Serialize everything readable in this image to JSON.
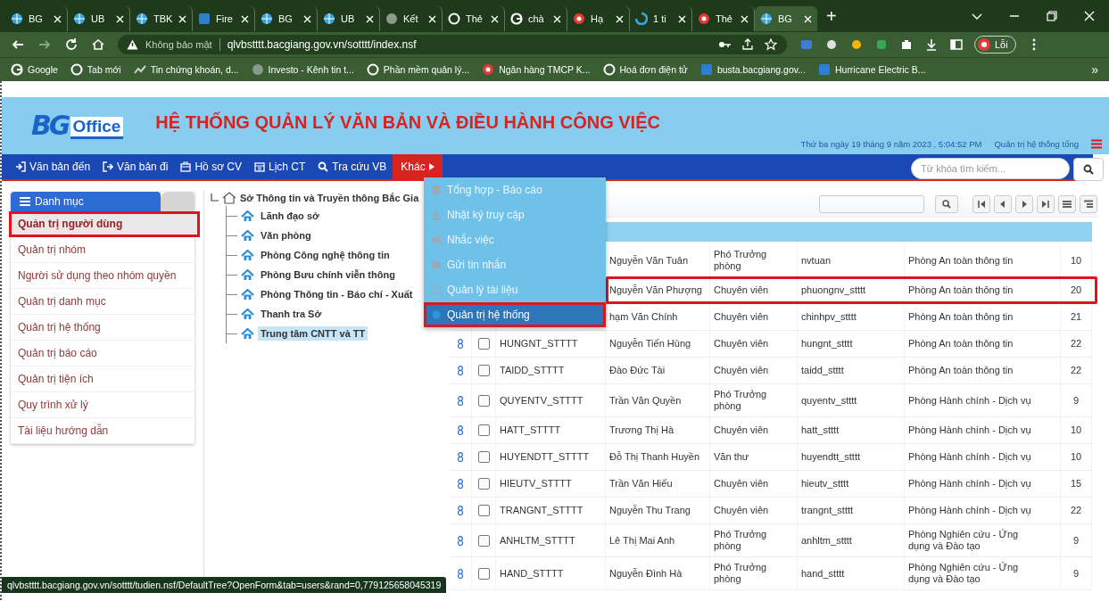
{
  "browser": {
    "tabs": [
      {
        "label": "BG",
        "kind": "globe",
        "selected": false
      },
      {
        "label": "UB",
        "kind": "globe",
        "selected": false
      },
      {
        "label": "TBK",
        "kind": "globe",
        "selected": false
      },
      {
        "label": "Fire",
        "kind": "square",
        "selected": false
      },
      {
        "label": "BG",
        "kind": "globe",
        "selected": false
      },
      {
        "label": "UB",
        "kind": "globe",
        "selected": false
      },
      {
        "label": "Kết",
        "kind": "grey",
        "selected": false
      },
      {
        "label": "Thẻ",
        "kind": "circle",
        "selected": false
      },
      {
        "label": "chà",
        "kind": "google",
        "selected": false
      },
      {
        "label": "Hạ",
        "kind": "red",
        "selected": false
      },
      {
        "label": "1 ti",
        "kind": "blue",
        "selected": false
      },
      {
        "label": "Thẻ",
        "kind": "red",
        "selected": false
      },
      {
        "label": "BG",
        "kind": "globe",
        "selected": true
      }
    ],
    "address": {
      "security": "Không bảo mật",
      "url": "qlvbstttt.bacgiang.gov.vn/sotttt/index.nsf",
      "profile_label": "Lỗi"
    },
    "bookmarks": [
      {
        "label": "Google",
        "kind": "google"
      },
      {
        "label": "Tab mới",
        "kind": "circle"
      },
      {
        "label": "Tin chứng khoán, d...",
        "kind": "inv"
      },
      {
        "label": "Investo - Kênh tin t...",
        "kind": "grey"
      },
      {
        "label": "Phần mềm quản lý...",
        "kind": "circle"
      },
      {
        "label": "Ngân hàng TMCP K...",
        "kind": "red"
      },
      {
        "label": "Hoá đơn điện tử",
        "kind": "circle"
      },
      {
        "label": "busta.bacgiang.gov...",
        "kind": "square"
      },
      {
        "label": "Hurricane Electric B...",
        "kind": "square"
      }
    ],
    "bookmarks_more": "»",
    "new_tab_label": "+"
  },
  "app": {
    "logo_mark": "BG",
    "logo_text": "Office",
    "title": "HỆ THỐNG QUẢN LÝ VĂN BẢN VÀ ĐIỀU HÀNH CÔNG VIỆC",
    "datetime": "Thứ ba ngày 19 tháng 9 năm 2023 , 5:04:52 PM",
    "user": "Quản trị hệ thống tổng"
  },
  "nav": {
    "items": [
      {
        "label": "Văn bản đến",
        "kind": "in",
        "selected": false
      },
      {
        "label": "Văn bản đi",
        "kind": "out",
        "selected": false
      },
      {
        "label": "Hồ sơ CV",
        "kind": "folder",
        "selected": false
      },
      {
        "label": "Lịch CT",
        "kind": "calendar",
        "selected": false
      },
      {
        "label": "Tra cứu VB",
        "kind": "search",
        "selected": false
      },
      {
        "label": "Khác",
        "kind": "more",
        "selected": true
      }
    ],
    "search": {
      "placeholder": "Từ khóa tìm kiếm..."
    }
  },
  "sidebar": {
    "title": "Danh mục",
    "items": [
      {
        "label": "Quản trị người dùng",
        "selected": true
      },
      {
        "label": "Quản trị nhóm",
        "selected": false
      },
      {
        "label": "Người sử dụng theo nhóm quyền",
        "selected": false
      },
      {
        "label": "Quản trị danh mục",
        "selected": false
      },
      {
        "label": "Quản trị hệ thống",
        "selected": false
      },
      {
        "label": "Quản trị báo cáo",
        "selected": false
      },
      {
        "label": "Quản trị tiện ích",
        "selected": false
      },
      {
        "label": "Quy trình xử lý",
        "selected": false
      },
      {
        "label": "Tài liệu hướng dẫn",
        "selected": false
      }
    ]
  },
  "tree": {
    "label": "Sở Thông tin và Truyền thông Bắc Gia",
    "expanded": true,
    "children": [
      {
        "label": "Lãnh đạo sở",
        "selected": false
      },
      {
        "label": "Văn phòng",
        "selected": false
      },
      {
        "label": "Phòng Công nghệ thông tin",
        "selected": false
      },
      {
        "label": "Phòng Bưu chính viễn thông",
        "selected": false
      },
      {
        "label": "Phòng Thông tin - Báo chí - Xuất",
        "selected": false
      },
      {
        "label": "Thanh tra Sở",
        "selected": false
      },
      {
        "label": "Trung tâm CNTT và TT",
        "selected": true
      }
    ]
  },
  "menu": {
    "items": [
      {
        "label": "Tổng hợp - Báo cáo",
        "kind": "report",
        "selected": false
      },
      {
        "label": "Nhật ký truy cập",
        "kind": "download",
        "selected": false
      },
      {
        "label": "Nhắc việc",
        "kind": "bullhorn",
        "selected": false
      },
      {
        "label": "Gửi tin nhắn",
        "kind": "mail",
        "selected": false
      },
      {
        "label": "Quản lý tài liệu",
        "kind": "folder",
        "selected": false
      },
      {
        "label": "Quản trị hệ thống",
        "kind": "dot",
        "selected": true
      }
    ]
  },
  "table": {
    "rows": [
      {
        "column_4": "Nguyễn Văn Tuân",
        "column_5": "Phó Trưởng phòng",
        "column_6": "nvtuan",
        "column_7": "Phòng An toàn thông tin",
        "column_8": "10",
        "highlighted": false
      },
      {
        "column_4": "Nguyễn Văn Phượng",
        "column_5": "Chuyên viên",
        "column_6": "phuongnv_stttt",
        "column_7": "Phòng An toàn thông tin",
        "column_8": "20",
        "highlighted": true
      },
      {
        "column_4": "hạm Văn Chính",
        "column_5": "Chuyên viên",
        "column_6": "chinhpv_stttt",
        "column_7": "Phòng An toàn thông tin",
        "column_8": "21",
        "highlighted": false
      },
      {
        "checked": false,
        "column_3": "HUNGNT_STTTT",
        "column_4": "Nguyễn Tiến Hùng",
        "column_5": "Chuyên viên",
        "column_6": "hungnt_stttt",
        "column_7": "Phòng An toàn thông tin",
        "column_8": "22",
        "highlighted": false
      },
      {
        "checked": false,
        "column_3": "TAIDD_STTTT",
        "column_4": "Đào Đức Tài",
        "column_5": "Chuyên viên",
        "column_6": "taidd_stttt",
        "column_7": "Phòng An toàn thông tin",
        "column_8": "22",
        "highlighted": false
      },
      {
        "checked": false,
        "column_3": "QUYENTV_STTTT",
        "column_4": "Trần Văn Quyền",
        "column_5": "Phó Trưởng phòng",
        "column_6": "quyentv_stttt",
        "column_7": "Phòng Hành chính - Dịch vụ",
        "column_8": "9",
        "highlighted": false
      },
      {
        "checked": false,
        "column_3": "HATT_STTTT",
        "column_4": "Trương Thị Hà",
        "column_5": "Chuyên viên",
        "column_6": "hatt_stttt",
        "column_7": "Phòng Hành chính - Dịch vụ",
        "column_8": "10",
        "highlighted": false
      },
      {
        "checked": false,
        "column_3": "HUYENDTT_STTTT",
        "column_4": "Đỗ Thị Thanh Huyền",
        "column_5": "Văn thư",
        "column_6": "huyendtt_stttt",
        "column_7": "Phòng Hành chính - Dịch vụ",
        "column_8": "10",
        "highlighted": false
      },
      {
        "checked": false,
        "column_3": "HIEUTV_STTTT",
        "column_4": "Trần Văn Hiếu",
        "column_5": "Chuyên viên",
        "column_6": "hieutv_stttt",
        "column_7": "Phòng Hành chính - Dịch vụ",
        "column_8": "15",
        "highlighted": false
      },
      {
        "checked": false,
        "column_3": "TRANGNT_STTTT",
        "column_4": "Nguyễn Thu Trang",
        "column_5": "Chuyên viên",
        "column_6": "trangnt_stttt",
        "column_7": "Phòng Hành chính - Dịch vụ",
        "column_8": "22",
        "highlighted": false
      },
      {
        "checked": false,
        "column_3": "ANHLTM_STTTT",
        "column_4": "Lê Thị Mai Anh",
        "column_5": "Phó Trưởng phòng",
        "column_6": "anhltm_stttt",
        "column_7": "Phòng Nghiên cứu - Ứng dụng và Đào tạo",
        "column_8": "9",
        "highlighted": false
      },
      {
        "checked": false,
        "column_3": "HAND_STTTT",
        "column_4": "Nguyễn Đình Hà",
        "column_5": "Phó Trưởng phòng",
        "column_6": "hand_stttt",
        "column_7": "Phòng Nghiên cứu - Ứng dụng và Đào tạo",
        "column_8": "9",
        "highlighted": false
      }
    ]
  },
  "status_url": "qlvbstttt.bacgiang.gov.vn/sotttt/tudien.nsf/DefaultTree?OpenForm&tab=users&rand=0,779125658045319"
}
